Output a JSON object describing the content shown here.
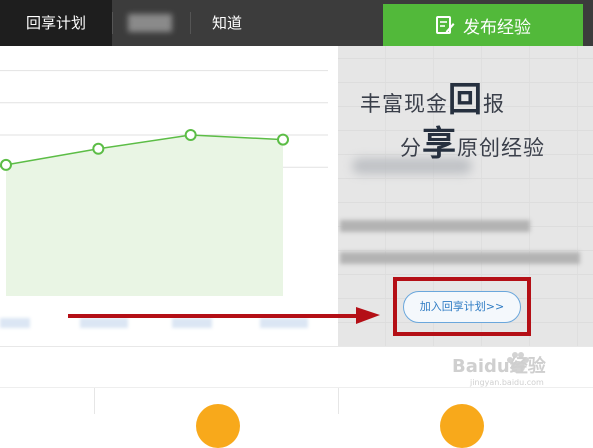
{
  "nav": {
    "items": [
      {
        "label": "回享计划",
        "active": true
      },
      {
        "label": "知道",
        "active": false
      }
    ],
    "publish_label": "发布经验",
    "publish_icon": "edit-note-icon"
  },
  "chart_data": {
    "type": "area",
    "x": [
      1,
      2,
      3,
      4
    ],
    "values": [
      57,
      64,
      70,
      68
    ],
    "ylim": [
      0,
      100
    ],
    "grid": true,
    "title": "",
    "xlabel": "",
    "ylabel": "",
    "colors": {
      "line": "#5cbd46",
      "fill": "#e9f5e4",
      "grid": "#e2e2e2"
    }
  },
  "promo": {
    "slogan_line1_a": "丰富现金",
    "slogan_line1_big": "回",
    "slogan_line1_b": "报",
    "slogan_line2_a": "分",
    "slogan_line2_big": "享",
    "slogan_line2_b": "原创经验",
    "join_button_label": "加入回享计划>>"
  },
  "watermark": {
    "text": "Baidu经验",
    "url_text": "jingyan.baidu.com"
  },
  "colors": {
    "topbar": "#3c3c3c",
    "publish_green": "#52b93a",
    "highlight_red": "#b40f16",
    "link_blue": "#2f7cc4",
    "accent_orange": "#f8a91b"
  }
}
